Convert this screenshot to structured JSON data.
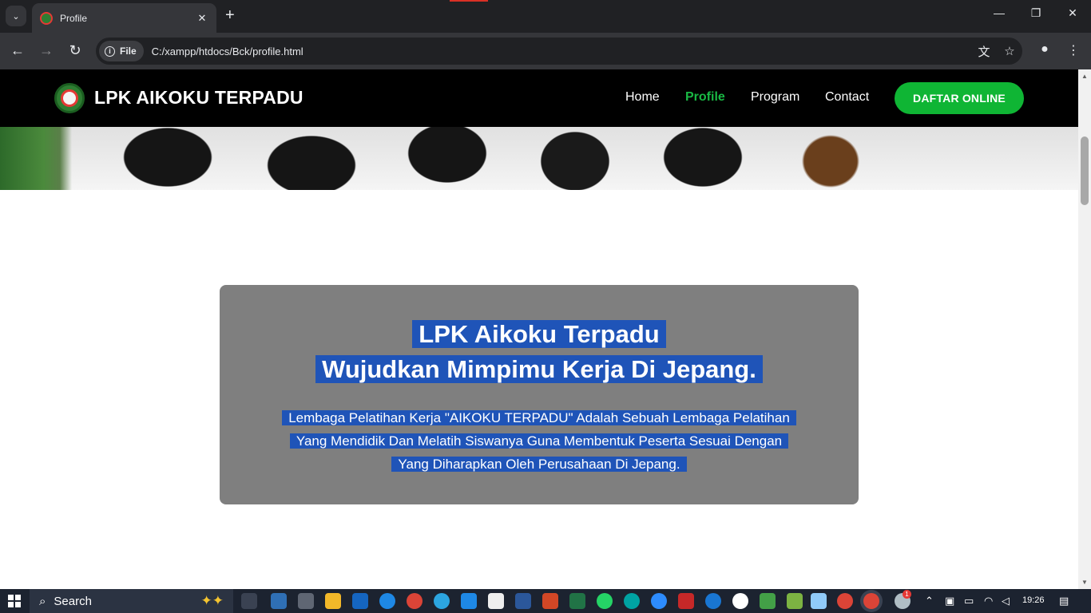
{
  "browser": {
    "tab_title": "Profile",
    "tab_close": "✕",
    "new_tab": "+",
    "chip_label": "File",
    "url": "C:/xampp/htdocs/Bck/profile.html",
    "window_minimize": "—",
    "window_restore": "❐",
    "window_close": "✕"
  },
  "site": {
    "brand": "LPK AIKOKU TERPADU",
    "nav": {
      "home": "Home",
      "profile": "Profile",
      "program": "Program",
      "contact": "Contact"
    },
    "cta": "DAFTAR ONLINE",
    "accent_color": "#0fb534",
    "hero_card": {
      "title_line1": "LPK Aikoku Terpadu",
      "title_line2": "Wujudkan Mimpimu Kerja Di Jepang.",
      "desc_line1": "Lembaga Pelatihan Kerja \"AIKOKU TERPADU\" Adalah Sebuah Lembaga Pelatihan",
      "desc_line2": "Yang Mendidik Dan Melatih Siswanya Guna Membentuk Peserta Sesuai Dengan",
      "desc_line3": "Yang Diharapkan Oleh Perusahaan Di Jepang."
    }
  },
  "taskbar": {
    "search_label": "Search",
    "clock": "19:26",
    "notification_badge": "1"
  }
}
